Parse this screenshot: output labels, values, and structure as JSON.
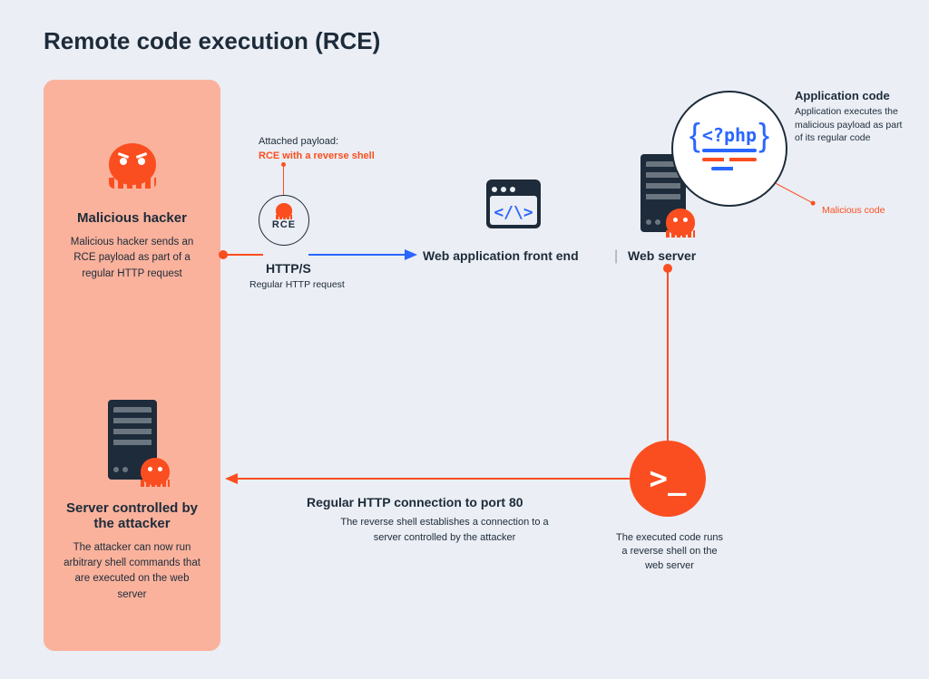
{
  "title": "Remote code execution (RCE)",
  "hacker": {
    "title": "Malicious hacker",
    "text": "Malicious hacker sends an RCE payload as part of a regular HTTP request"
  },
  "attacker_server": {
    "title": "Server controlled by the attacker",
    "text": "The attacker can now run arbitrary shell commands that are executed on the web server"
  },
  "payload": {
    "label": "Attached payload:",
    "sub": "RCE with a reverse shell"
  },
  "rce_badge": "RCE",
  "http": {
    "label": "HTTP/S",
    "sub": "Regular HTTP request"
  },
  "webapp_label": "Web application front end",
  "separator": "|",
  "webserver_label": "Web server",
  "browser_code": "</\\>",
  "appcode": {
    "title": "Application code",
    "text": "Application executes the malicious payload as part of its regular code",
    "php": "<?php",
    "malicious": "Malicious code"
  },
  "shell": {
    "prompt": ">_",
    "text": "The executed code runs a reverse shell on the web server"
  },
  "port80": {
    "title": "Regular HTTP connection to port 80",
    "text": "The reverse shell establishes a connection to a server controlled by the attacker"
  },
  "colors": {
    "accent": "#fb4e20",
    "blue": "#2a66ff",
    "dark": "#1d2b3a",
    "bg": "#ebeef4",
    "panel": "#fab29c"
  }
}
